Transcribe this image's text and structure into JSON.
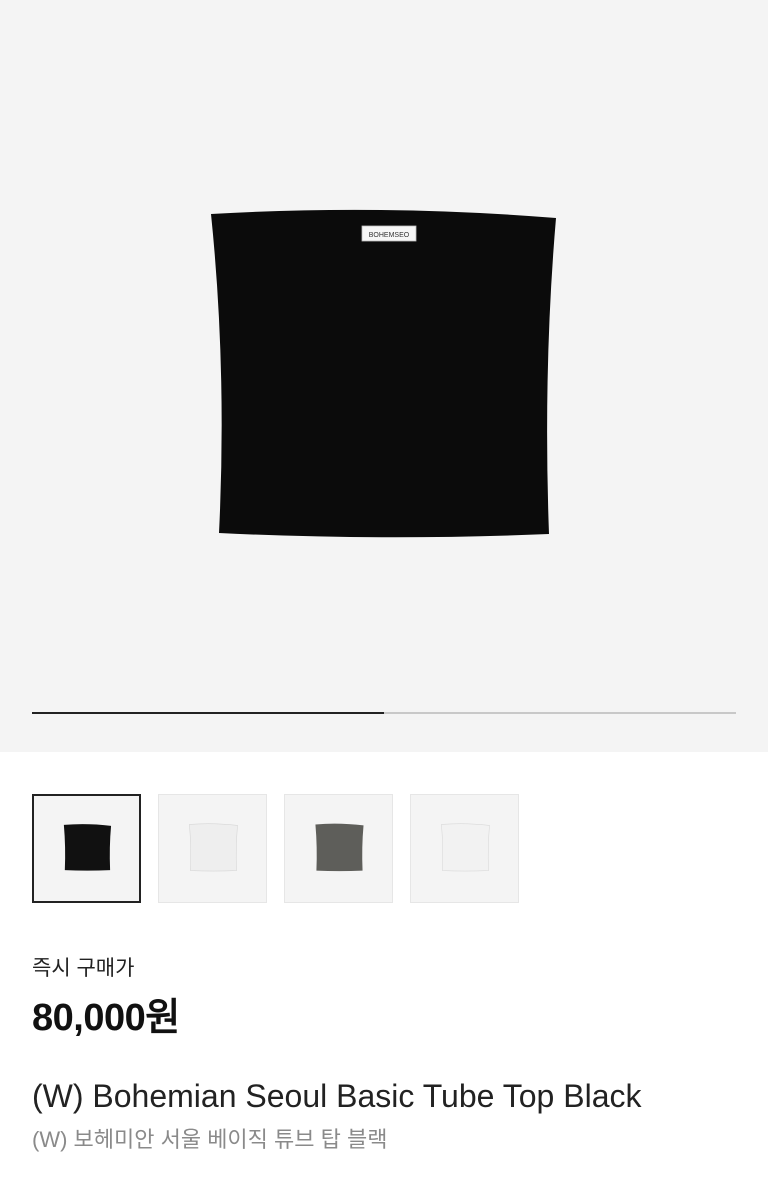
{
  "hero": {
    "image_icon": "tube-top-product-image",
    "label_text": "BOHEMSEO",
    "gallery_progress": 0.5
  },
  "thumbnails": [
    {
      "color": "#111111",
      "icon": "tube-top-black-thumbnail",
      "selected": true
    },
    {
      "color": "#eeeeee",
      "icon": "tube-top-white-thumbnail",
      "selected": false
    },
    {
      "color": "#5e5e5a",
      "icon": "tube-top-charcoal-thumbnail",
      "selected": false
    },
    {
      "color": "#f2f2f2",
      "icon": "tube-top-light-gray-thumbnail",
      "selected": false
    }
  ],
  "price": {
    "label": "즉시 구매가",
    "value": "80,000원"
  },
  "product": {
    "title_en": "(W) Bohemian Seoul Basic Tube Top Black",
    "title_ko": "(W) 보헤미안 서울 베이직 튜브 탑 블랙"
  }
}
